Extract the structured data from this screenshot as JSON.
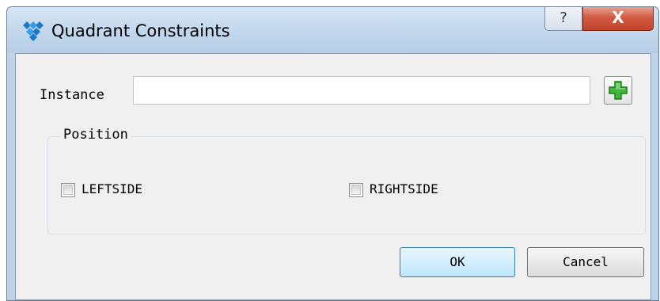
{
  "window": {
    "title": "Quadrant Constraints",
    "help_label": "?",
    "close_label": "X"
  },
  "instance": {
    "label": "Instance",
    "value": "",
    "add_icon": "add-icon",
    "add_icon_color": "#3fb53a"
  },
  "position": {
    "title": "Position",
    "options": [
      {
        "label": "LEFTSIDE",
        "checked": false
      },
      {
        "label": "RIGHTSIDE",
        "checked": false
      }
    ]
  },
  "buttons": {
    "ok": "OK",
    "cancel": "Cancel"
  }
}
